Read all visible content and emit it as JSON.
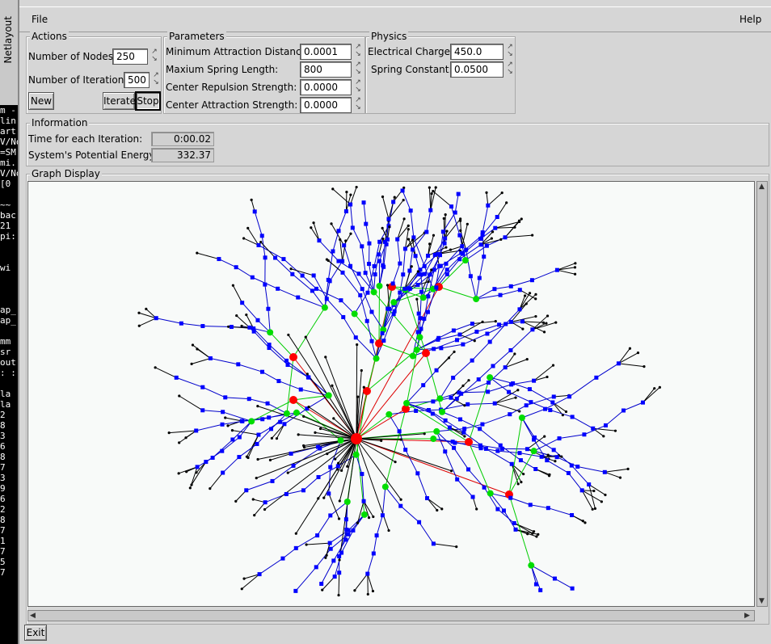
{
  "terminal": {
    "title": "Netlayout",
    "lines": [
      "m -",
      "lin",
      "art",
      "V/No",
      "=SM",
      "mi.",
      "V/No",
      "[0",
      "",
      "~~",
      "bac",
      "21",
      "pi:",
      "",
      "",
      "wi",
      "",
      "",
      "",
      "ap_",
      "ap_",
      "",
      "mm",
      "sr",
      "out",
      ": :",
      "",
      "la",
      "la",
      "2",
      "8",
      "3",
      "6",
      "8",
      "7",
      "3",
      "9",
      "6",
      "2",
      "8",
      "7",
      "1",
      "7",
      "5",
      "7"
    ]
  },
  "menu": {
    "file": "File",
    "help": "Help"
  },
  "actions": {
    "title": "Actions",
    "nodes_label": "Number of Nodes:",
    "nodes_value": "250",
    "iterations_label": "Number of Iterations:",
    "iterations_value": "500",
    "new_label": "New",
    "iterate_label": "Iterate",
    "stop_label": "Stop"
  },
  "parameters": {
    "title": "Parameters",
    "min_attr_label": "Minimum Attraction Distance:",
    "min_attr_value": "0.0001",
    "max_spring_label": "Maxium Spring Length:",
    "max_spring_value": "800",
    "center_rep_label": "Center Repulsion Strength:",
    "center_rep_value": "0.0000",
    "center_attr_label": "Center Attraction Strength:",
    "center_attr_value": "0.0000"
  },
  "physics": {
    "title": "Physics",
    "charge_label": "Electrical Charge:",
    "charge_value": "450.0",
    "spring_label": "Spring Constant:",
    "spring_value": "0.0500"
  },
  "information": {
    "title": "Information",
    "time_label": "Time for each Iteration:",
    "time_value": "0:00.02",
    "energy_label": "System's Potential Energy:",
    "energy_value": "332.37"
  },
  "graph": {
    "title": "Graph Display",
    "colors": {
      "root": "#ff0000",
      "level1": "#00dd00",
      "level2": "#0000ff",
      "leaf": "#000000",
      "edge_red": "#dd0000",
      "edge_green": "#00cc00",
      "edge_blue": "#0000cc",
      "edge_black": "#000000"
    }
  },
  "footer": {
    "exit_label": "Exit"
  }
}
